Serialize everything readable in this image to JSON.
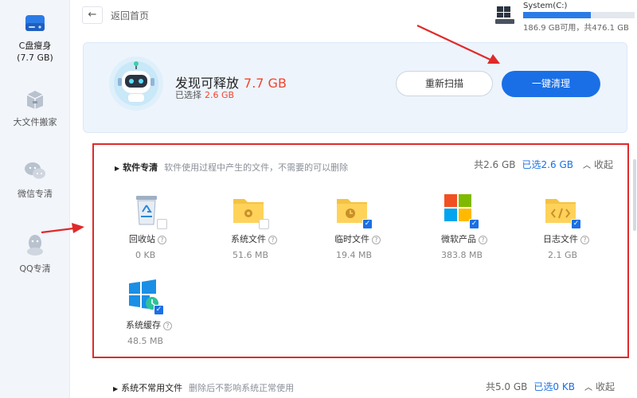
{
  "sidebar": {
    "items": [
      {
        "label": "C盘瘦身",
        "sub": "(7.7 GB)",
        "icon": "disk-icon",
        "active": true
      },
      {
        "label": "大文件搬家",
        "icon": "box-icon"
      },
      {
        "label": "微信专清",
        "icon": "wechat-icon"
      },
      {
        "label": "QQ专清",
        "icon": "qq-icon"
      }
    ]
  },
  "topbar": {
    "back_label": "返回首页",
    "disk_name": "System(C:)",
    "disk_text": "186.9 GB可用，共476.1 GB",
    "disk_used_fraction": 0.61
  },
  "hero": {
    "title": "发现可释放",
    "title_amount": "7.7 GB",
    "sub": "已选择",
    "sub_amount": "2.6 GB",
    "rescan_label": "重新扫描",
    "clean_label": "一键清理"
  },
  "section1": {
    "name": "软件专清",
    "desc": "软件使用过程中产生的文件，不需要的可以删除",
    "total": "共2.6 GB",
    "selected": "已选2.6 GB",
    "collapse_label": "收起",
    "items": [
      {
        "name": "回收站",
        "size": "0 KB",
        "icon": "recycle-bin-icon",
        "checked": false
      },
      {
        "name": "系统文件",
        "size": "51.6 MB",
        "icon": "system-folder-icon",
        "checked": false
      },
      {
        "name": "临时文件",
        "size": "19.4 MB",
        "icon": "temp-folder-icon",
        "checked": true
      },
      {
        "name": "微软产品",
        "size": "383.8 MB",
        "icon": "microsoft-icon",
        "checked": true
      },
      {
        "name": "日志文件",
        "size": "2.1 GB",
        "icon": "log-folder-icon",
        "checked": true
      },
      {
        "name": "系统缓存",
        "size": "48.5 MB",
        "icon": "windows-cache-icon",
        "checked": true
      }
    ]
  },
  "section2": {
    "name": "系统不常用文件",
    "desc": "删除后不影响系统正常使用",
    "total": "共5.0 GB",
    "selected": "已选0 KB",
    "collapse_label": "收起"
  },
  "colors": {
    "accent": "#1a6fe6",
    "highlight": "#f5432d",
    "annotation": "#e02a2a"
  }
}
